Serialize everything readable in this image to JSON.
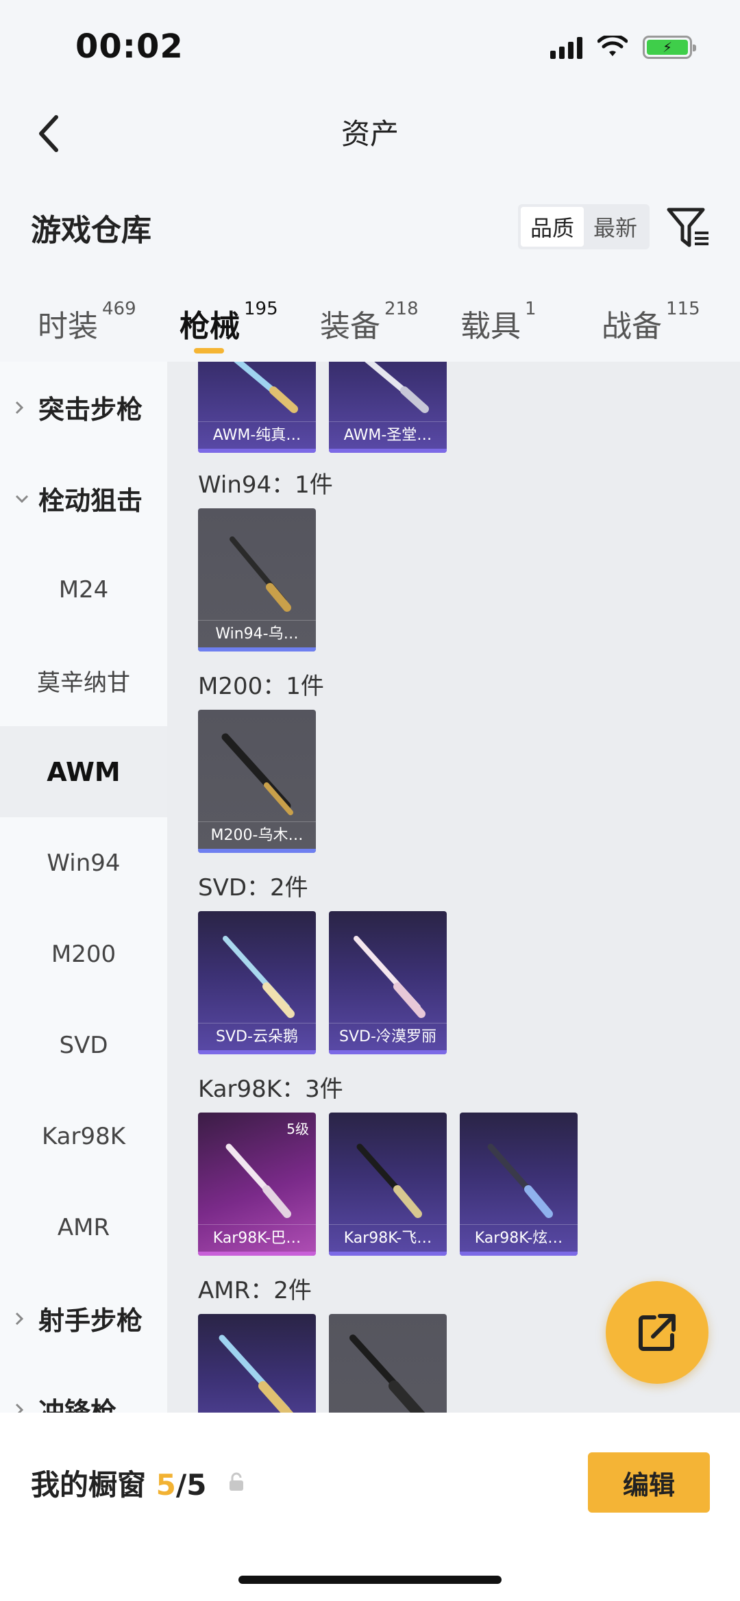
{
  "status": {
    "time": "00:02"
  },
  "header": {
    "title": "资产"
  },
  "section": {
    "title": "游戏仓库",
    "sort_options": [
      "品质",
      "最新"
    ],
    "active_sort": "品质"
  },
  "tabs": [
    {
      "label": "时装",
      "count": "469"
    },
    {
      "label": "枪械",
      "count": "195"
    },
    {
      "label": "装备",
      "count": "218"
    },
    {
      "label": "载具",
      "count": "1"
    },
    {
      "label": "战备",
      "count": "115"
    }
  ],
  "sidebar": {
    "cat_assault": "突击步枪",
    "cat_bolt": "栓动狙击",
    "subs": [
      "M24",
      "莫辛纳甘",
      "AWM",
      "Win94",
      "M200",
      "SVD",
      "Kar98K",
      "AMR"
    ],
    "active_sub": "AWM",
    "cat_marksman": "射手步枪",
    "cat_smg": "冲锋枪"
  },
  "groups": {
    "awm": {
      "items": [
        "AWM-纯真…",
        "AWM-圣堂…"
      ]
    },
    "win94": {
      "label": "Win94：1件",
      "items": [
        "Win94-乌…"
      ]
    },
    "m200": {
      "label": "M200：1件",
      "items": [
        "M200-乌木…"
      ]
    },
    "svd": {
      "label": "SVD：2件",
      "items": [
        "SVD-云朵鹅",
        "SVD-冷漠罗丽"
      ]
    },
    "kar98k": {
      "label": "Kar98K：3件",
      "items": [
        "Kar98K-巴…",
        "Kar98K-飞…",
        "Kar98K-炫…"
      ],
      "level": "5级"
    },
    "amr": {
      "label": "AMR：2件"
    }
  },
  "showcase": {
    "label": "我的橱窗",
    "count": "5",
    "total": "/5",
    "edit_label": "编辑"
  },
  "colors": {
    "accent": "#f4b436",
    "rare_purple": "#5a4aa8",
    "legend_pink": "#b04fb5"
  }
}
